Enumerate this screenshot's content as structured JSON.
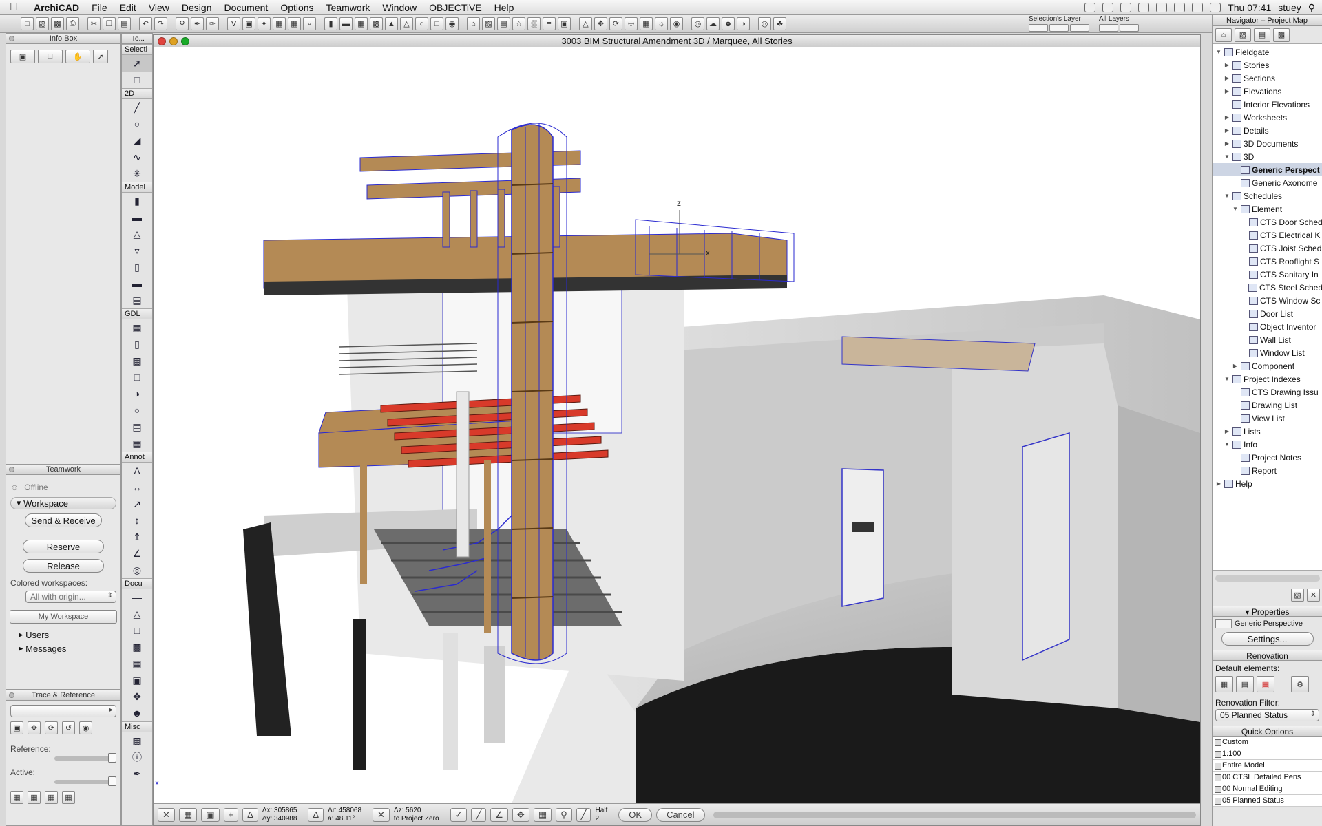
{
  "menubar": {
    "app": "ArchiCAD",
    "items": [
      "File",
      "Edit",
      "View",
      "Design",
      "Document",
      "Options",
      "Teamwork",
      "Window",
      "OBJECTiVE",
      "Help"
    ],
    "clock": "Thu 07:41",
    "user": "stuey"
  },
  "layers": {
    "selection_label": "Selection's Layer",
    "all_label": "All Layers"
  },
  "infobox": {
    "title": "Info Box"
  },
  "toolbox": {
    "title": "To...",
    "selection_group": "Selecti",
    "groups": [
      "2D",
      "Model",
      "GDL",
      "Annot",
      "Docu",
      "Misc"
    ]
  },
  "teamwork": {
    "title": "Teamwork",
    "status": "Offline",
    "workspace": "Workspace",
    "send_receive": "Send & Receive",
    "reserve": "Reserve",
    "release": "Release",
    "colored_label": "Colored workspaces:",
    "colored_value": "All with origin...",
    "my_workspace": "My Workspace",
    "users": "Users",
    "messages": "Messages"
  },
  "trace": {
    "title": "Trace & Reference",
    "reference_label": "Reference:",
    "active_label": "Active:"
  },
  "window3d": {
    "title": "3003 BIM Structural Amendment 3D / Marquee, All Stories",
    "axis_z": "z",
    "axis_x": "x",
    "origin_x": "x"
  },
  "statusbar": {
    "dx": "Δx: 305865",
    "dy": "Δy: 340988",
    "dr": "Δr: 458068",
    "da": "a: 48.11°",
    "dz": "Δz: 5620",
    "to_project": "to Project Zero",
    "half": "Half",
    "half_val": "2",
    "ok": "OK",
    "cancel": "Cancel"
  },
  "navigator": {
    "title": "Navigator – Project Map",
    "tree": [
      {
        "label": "Fieldgate",
        "level": 0,
        "open": true
      },
      {
        "label": "Stories",
        "level": 1,
        "open": false
      },
      {
        "label": "Sections",
        "level": 1,
        "open": false
      },
      {
        "label": "Elevations",
        "level": 1,
        "open": false
      },
      {
        "label": "Interior Elevations",
        "level": 1,
        "leaf": true
      },
      {
        "label": "Worksheets",
        "level": 1,
        "open": false
      },
      {
        "label": "Details",
        "level": 1,
        "open": false
      },
      {
        "label": "3D Documents",
        "level": 1,
        "open": false
      },
      {
        "label": "3D",
        "level": 1,
        "open": true
      },
      {
        "label": "Generic Perspect",
        "level": 2,
        "leaf": true,
        "selected": true
      },
      {
        "label": "Generic Axonome",
        "level": 2,
        "leaf": true
      },
      {
        "label": "Schedules",
        "level": 1,
        "open": true
      },
      {
        "label": "Element",
        "level": 2,
        "open": true
      },
      {
        "label": "CTS Door Sched",
        "level": 3,
        "leaf": true
      },
      {
        "label": "CTS Electrical K",
        "level": 3,
        "leaf": true
      },
      {
        "label": "CTS Joist Sched",
        "level": 3,
        "leaf": true
      },
      {
        "label": "CTS Rooflight S",
        "level": 3,
        "leaf": true
      },
      {
        "label": "CTS Sanitary In",
        "level": 3,
        "leaf": true
      },
      {
        "label": "CTS Steel Sched",
        "level": 3,
        "leaf": true
      },
      {
        "label": "CTS Window Sc",
        "level": 3,
        "leaf": true
      },
      {
        "label": "Door List",
        "level": 3,
        "leaf": true
      },
      {
        "label": "Object Inventor",
        "level": 3,
        "leaf": true
      },
      {
        "label": "Wall List",
        "level": 3,
        "leaf": true
      },
      {
        "label": "Window List",
        "level": 3,
        "leaf": true
      },
      {
        "label": "Component",
        "level": 2,
        "open": false
      },
      {
        "label": "Project Indexes",
        "level": 1,
        "open": true
      },
      {
        "label": "CTS Drawing Issu",
        "level": 2,
        "leaf": true
      },
      {
        "label": "Drawing List",
        "level": 2,
        "leaf": true
      },
      {
        "label": "View List",
        "level": 2,
        "leaf": true
      },
      {
        "label": "Lists",
        "level": 1,
        "open": false
      },
      {
        "label": "Info",
        "level": 1,
        "open": true
      },
      {
        "label": "Project Notes",
        "level": 2,
        "leaf": true
      },
      {
        "label": "Report",
        "level": 2,
        "leaf": true
      },
      {
        "label": "Help",
        "level": 0,
        "open": false
      }
    ]
  },
  "properties": {
    "title": "Properties",
    "name": "Generic Perspective",
    "settings": "Settings..."
  },
  "renovation": {
    "title": "Renovation",
    "default_label": "Default elements:",
    "filter_label": "Renovation Filter:",
    "filter_value": "05 Planned Status"
  },
  "quick_options": {
    "title": "Quick Options",
    "rows": [
      "Custom",
      "1:100",
      "Entire Model",
      "00 CTSL Detailed Pens",
      "00 Normal Editing",
      "05 Planned Status"
    ]
  },
  "colors": {
    "timber": "#b48a55",
    "wire": "#2a2ad0",
    "steel": "#d83a2a",
    "wall": "#c9c9c9"
  }
}
